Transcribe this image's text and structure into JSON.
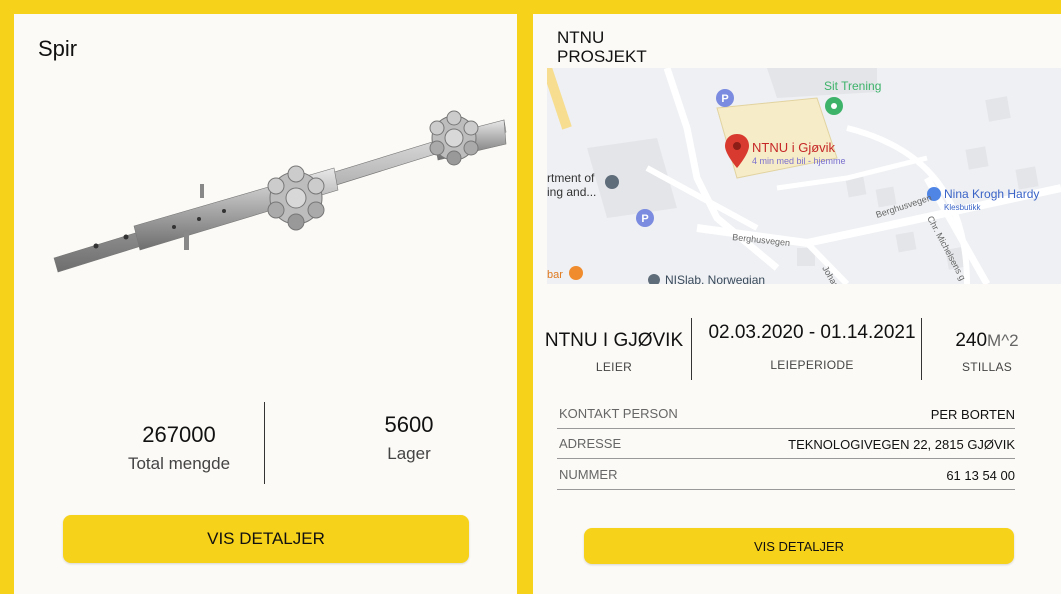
{
  "product_card": {
    "title": "Spir",
    "total_value": "267000",
    "total_label": "Total mengde",
    "lager_value": "5600",
    "lager_label": "Lager",
    "button_label": "VIS DETALJER"
  },
  "project_card": {
    "title": "NTNU\nPROSJEKT",
    "map": {
      "place_name": "NTNU i Gjøvik",
      "place_sub": "4 min med bil - hjemme",
      "label_trening": "Sit Trening",
      "label_department": "rtment of\ning and...",
      "label_nina": "Nina Krogh Hardy",
      "label_nina_sub": "Klesbutikk",
      "label_berghusvegen1": "Berghusvegen",
      "label_berghusvegen2": "Berghusvegen",
      "label_nislab": "NISlab, Norwegian",
      "label_johan": "Johan C",
      "label_chr": "Chr. Michelsens g",
      "label_bar": "bar"
    },
    "leier_value": "NTNU I GJØVIK",
    "leier_label": "LEIER",
    "periode_value": "02.03.2020 - 01.14.2021",
    "periode_label": "LEIEPERIODE",
    "stillas_value": "240",
    "stillas_unit": "M^2",
    "stillas_label": "STILLAS",
    "details": [
      {
        "key": "KONTAKT PERSON",
        "value": "PER BORTEN"
      },
      {
        "key": "ADRESSE",
        "value": "TEKNOLOGIVEGEN 22, 2815 GJØVIK"
      },
      {
        "key": "NUMMER",
        "value": "61 13 54 00"
      }
    ],
    "button_label": "VIS DETALJER"
  },
  "colors": {
    "accent": "#f7d21a",
    "card_bg": "#fbfaf6",
    "map_pin": "#d93a2f"
  }
}
